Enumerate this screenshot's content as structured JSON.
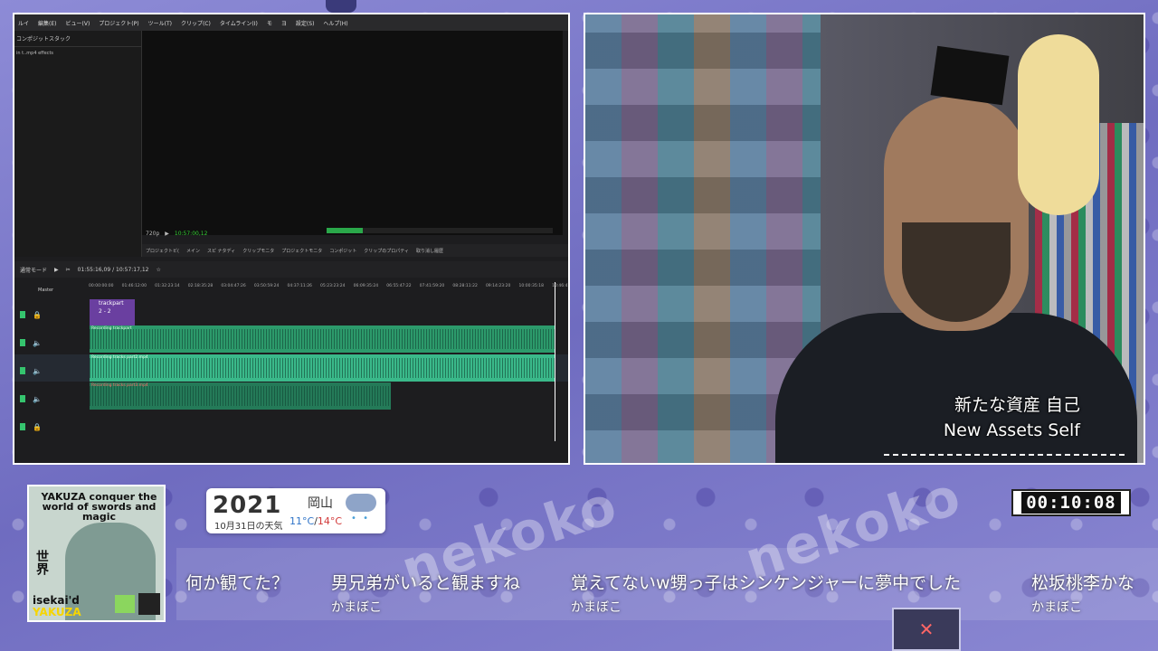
{
  "background": {
    "watermark": "nekoko"
  },
  "editor": {
    "menu": [
      "ルイ",
      "編集(E)",
      "ビュー(V)",
      "プロジェクト(P)",
      "ツール(T)",
      "クリップ(C)",
      "タイムライン(I)",
      "モ",
      "ヨ",
      "設定(S)",
      "ヘルプ(H)"
    ],
    "left_pane_title": "コンポジットスタック",
    "left_pane_row": "in t..mp4 effects",
    "resolution": "720p",
    "timecode_preview": "10:57:00,12",
    "tabs": [
      "プロジェクトビ(",
      "メイン",
      "スピ ナタディ",
      "クリップモニタ",
      "プロジェクトモニタ",
      "コンポジット",
      "クリップのプロパティ",
      "取り消し履歴"
    ],
    "timeline_mode": "通常モード",
    "timeline_position": "01:55:16,09 / 10:57:17,12",
    "master_label": "Master",
    "ruler": [
      "00:00:00:00",
      "01:46:12:00",
      "01:32:23:14",
      "02:18:35:28",
      "03:04:47:26",
      "03:50:59:24",
      "04:37:11:26",
      "05:23:23:24",
      "06:09:35:24",
      "06:55:47:22",
      "07:41:59:20",
      "08:28:11:22",
      "09:14:23:20",
      "10:00:35:18",
      "10:46:47:"
    ],
    "purple_clip_lines": [
      "trackpart",
      "2 - 2"
    ],
    "clip_labels": [
      "Recording trackpart",
      "Recording tracks part2.mp4",
      "Recording tracks part3.mp4"
    ]
  },
  "camera": {
    "caption_jp": "新たな資産 自己",
    "caption_en": "New Assets Self"
  },
  "book": {
    "title": "YAKUZA conquer the world of swords and magic",
    "title_jp": "世界",
    "bottom_line1": "isekai'd",
    "bottom_line2": "YAKUZA"
  },
  "weather": {
    "year": "2021",
    "date": "10月31日の天気",
    "city": "岡山",
    "temp_low": "11°C",
    "temp_sep": "/",
    "temp_high": "14°C",
    "drops": "• •"
  },
  "timer": {
    "value": "00:10:08"
  },
  "chat": [
    {
      "msg": "何か観てた？",
      "user": ""
    },
    {
      "msg": "男兄弟がいると観ますね",
      "user": "かまぼこ"
    },
    {
      "msg": "覚えてないw甥っ子はシンケンジャーに夢中でした",
      "user": "かまぼこ"
    },
    {
      "msg": "松坂桃李かな",
      "user": "かまぼこ"
    }
  ]
}
